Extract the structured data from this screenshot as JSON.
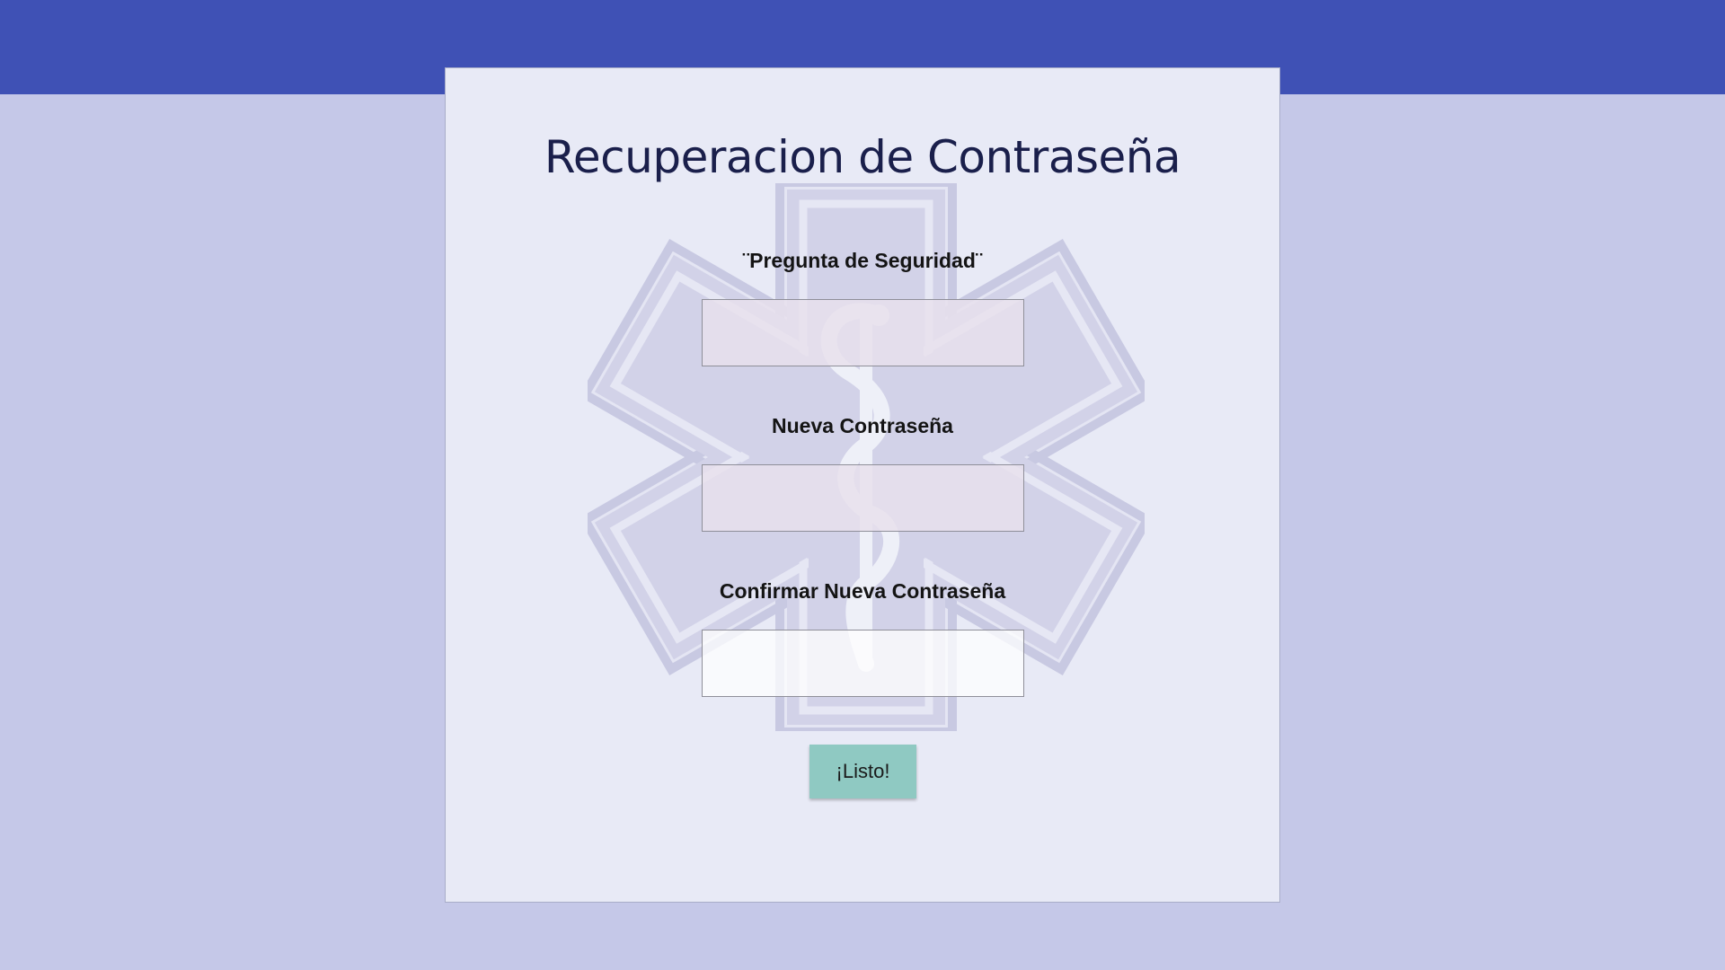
{
  "page": {
    "title": "Recuperacion de Contraseña"
  },
  "form": {
    "fields": [
      {
        "label": "¨Pregunta de Seguridad¨",
        "value": "",
        "placeholder": ""
      },
      {
        "label": "Nueva Contraseña",
        "value": "",
        "placeholder": ""
      },
      {
        "label": "Confirmar Nueva Contraseña",
        "value": "",
        "placeholder": ""
      }
    ],
    "submit_label": "¡Listo!"
  },
  "colors": {
    "header": "#3f51b5",
    "background": "#c5c8e8",
    "card": "#e8eaf6",
    "button": "#8fc9c2"
  },
  "icons": {
    "watermark": "star-of-life-icon"
  }
}
